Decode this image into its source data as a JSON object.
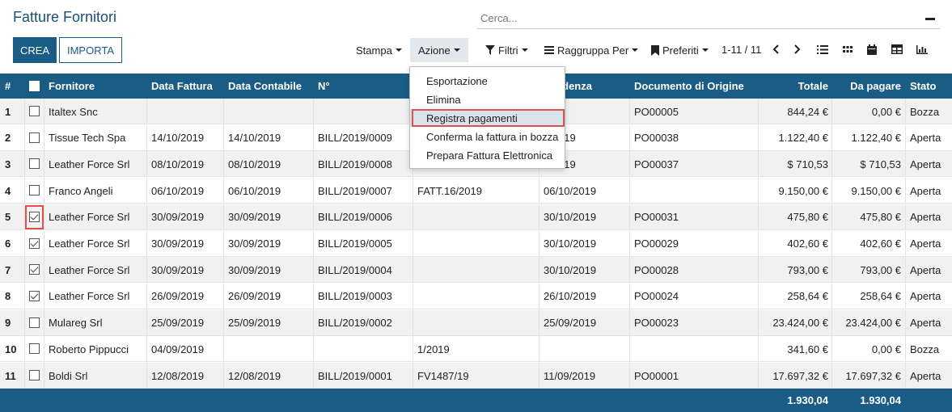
{
  "title": "Fatture Fornitori",
  "search": {
    "placeholder": "Cerca..."
  },
  "buttons": {
    "create": "CREA",
    "import": "IMPORTA"
  },
  "toolbar": {
    "print": "Stampa",
    "action": "Azione",
    "filters": "Filtri",
    "group_by": "Raggruppa Per",
    "favorites": "Preferiti",
    "pager": "1-11 / 11"
  },
  "columns": {
    "index": "#",
    "supplier": "Fornitore",
    "invoice_date": "Data Fattura",
    "accounting_date": "Data Contabile",
    "number": "N°",
    "due_date": "Scadenza",
    "origin": "Documento di Origine",
    "total": "Totale",
    "due_amount": "Da pagare",
    "state": "Stato"
  },
  "rows": [
    {
      "idx": "1",
      "checked": false,
      "supplier": "Italtex Snc",
      "invoice_date": "",
      "accounting_date": "",
      "number": "",
      "reference": "",
      "due_date": "",
      "origin": "PO00005",
      "total": "844,24 €",
      "due_amount": "0,00 €",
      "state": "Bozza"
    },
    {
      "idx": "2",
      "checked": false,
      "supplier": "Tissue Tech Spa",
      "invoice_date": "14/10/2019",
      "accounting_date": "14/10/2019",
      "number": "BILL/2019/0009",
      "reference": "",
      "due_date": "2/2019",
      "origin": "PO00038",
      "total": "1.122,40 €",
      "due_amount": "1.122,40 €",
      "state": "Aperta"
    },
    {
      "idx": "3",
      "checked": false,
      "supplier": "Leather Force Srl",
      "invoice_date": "08/10/2019",
      "accounting_date": "08/10/2019",
      "number": "BILL/2019/0008",
      "reference": "",
      "due_date": "1/2019",
      "origin": "PO00037",
      "total": "$ 710,53",
      "due_amount": "$ 710,53",
      "state": "Aperta"
    },
    {
      "idx": "4",
      "checked": false,
      "supplier": "Franco Angeli",
      "invoice_date": "06/10/2019",
      "accounting_date": "06/10/2019",
      "number": "BILL/2019/0007",
      "reference": "FATT.16/2019",
      "due_date": "06/10/2019",
      "origin": "",
      "total": "9.150,00 €",
      "due_amount": "9.150,00 €",
      "state": "Aperta"
    },
    {
      "idx": "5",
      "checked": true,
      "supplier": "Leather Force Srl",
      "invoice_date": "30/09/2019",
      "accounting_date": "30/09/2019",
      "number": "BILL/2019/0006",
      "reference": "",
      "due_date": "30/10/2019",
      "origin": "PO00031",
      "total": "475,80 €",
      "due_amount": "475,80 €",
      "state": "Aperta"
    },
    {
      "idx": "6",
      "checked": true,
      "supplier": "Leather Force Srl",
      "invoice_date": "30/09/2019",
      "accounting_date": "30/09/2019",
      "number": "BILL/2019/0005",
      "reference": "",
      "due_date": "30/10/2019",
      "origin": "PO00029",
      "total": "402,60 €",
      "due_amount": "402,60 €",
      "state": "Aperta"
    },
    {
      "idx": "7",
      "checked": true,
      "supplier": "Leather Force Srl",
      "invoice_date": "30/09/2019",
      "accounting_date": "30/09/2019",
      "number": "BILL/2019/0004",
      "reference": "",
      "due_date": "30/10/2019",
      "origin": "PO00028",
      "total": "793,00 €",
      "due_amount": "793,00 €",
      "state": "Aperta"
    },
    {
      "idx": "8",
      "checked": true,
      "supplier": "Leather Force Srl",
      "invoice_date": "26/09/2019",
      "accounting_date": "26/09/2019",
      "number": "BILL/2019/0003",
      "reference": "",
      "due_date": "26/10/2019",
      "origin": "PO00024",
      "total": "258,64 €",
      "due_amount": "258,64 €",
      "state": "Aperta"
    },
    {
      "idx": "9",
      "checked": false,
      "supplier": "Mulareg Srl",
      "invoice_date": "25/09/2019",
      "accounting_date": "25/09/2019",
      "number": "BILL/2019/0002",
      "reference": "",
      "due_date": "25/09/2019",
      "origin": "PO00023",
      "total": "23.424,00 €",
      "due_amount": "23.424,00 €",
      "state": "Aperta"
    },
    {
      "idx": "10",
      "checked": false,
      "supplier": "Roberto Pippucci",
      "invoice_date": "04/09/2019",
      "accounting_date": "",
      "number": "",
      "reference": "1/2019",
      "due_date": "",
      "origin": "",
      "total": "341,60 €",
      "due_amount": "0,00 €",
      "state": "Bozza"
    },
    {
      "idx": "11",
      "checked": false,
      "supplier": "Boldi Srl",
      "invoice_date": "12/08/2019",
      "accounting_date": "12/08/2019",
      "number": "BILL/2019/0001",
      "reference": "FV1487/19",
      "due_date": "11/09/2019",
      "origin": "PO00001",
      "total": "17.697,32 €",
      "due_amount": "17.697,32 €",
      "state": "Aperta"
    }
  ],
  "footer": {
    "total": "1.930,04",
    "due_amount": "1.930,04"
  },
  "action_menu": {
    "items": [
      "Esportazione",
      "Elimina",
      "Registra pagamenti",
      "Conferma la fattura in bozza",
      "Prepara Fattura Elettronica"
    ],
    "highlighted": "Registra pagamenti"
  },
  "icons": {
    "filter": "funnel-icon",
    "group": "list-lines-icon",
    "favorites": "bookmark-icon",
    "views": [
      "list-view-icon",
      "kanban-view-icon",
      "calendar-view-icon",
      "pivot-view-icon",
      "graph-view-icon"
    ]
  },
  "colors": {
    "brand": "#1b5c85",
    "highlight": "#e05050",
    "menu_active": "#d9e3ec"
  }
}
